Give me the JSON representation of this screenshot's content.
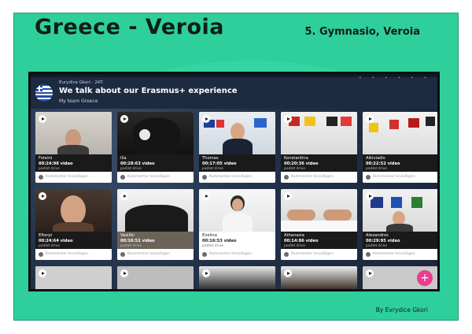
{
  "slide": {
    "title": "Greece - Veroia",
    "school": "5. Gymnasio, Veroia",
    "credit": "By Evrydice Gkori"
  },
  "padlet": {
    "author": "Eurydice Gkori",
    "time": "24T.",
    "title": "We talk about our Erasmus+ experience",
    "subtitle": "My team Greece",
    "comment_placeholder": "Kommentar hinzufügen",
    "add_icon": "plus-icon",
    "posts": [
      {
        "name": "Foteini",
        "duration": "00:24:98 video",
        "source": "padlet drive"
      },
      {
        "name": "Ilia",
        "duration": "00:28:63 video",
        "source": "padlet drive"
      },
      {
        "name": "Thomas",
        "duration": "00:17:05 video",
        "source": "padlet drive"
      },
      {
        "name": "Konstantina",
        "duration": "00:20:36 video",
        "source": "padlet drive"
      },
      {
        "name": "Alkiviadis",
        "duration": "00:22:52 video",
        "source": "padlet drive"
      },
      {
        "name": "Efterpi",
        "duration": "00:24:64 video",
        "source": "padlet drive"
      },
      {
        "name": "Vasiliki",
        "duration": "00:16:51 video",
        "source": "padlet drive"
      },
      {
        "name": "Evelina",
        "duration": "00:16:53 video",
        "source": "padlet drive"
      },
      {
        "name": "Athanasia",
        "duration": "00:14:86 video",
        "source": "padlet drive"
      },
      {
        "name": "Alexandros",
        "duration": "00:29:95 video",
        "source": "padlet drive"
      }
    ]
  },
  "colors": {
    "slide_bg": "#2fcf9c",
    "board_header": "#1d2b40",
    "fab": "#e83e8c"
  }
}
